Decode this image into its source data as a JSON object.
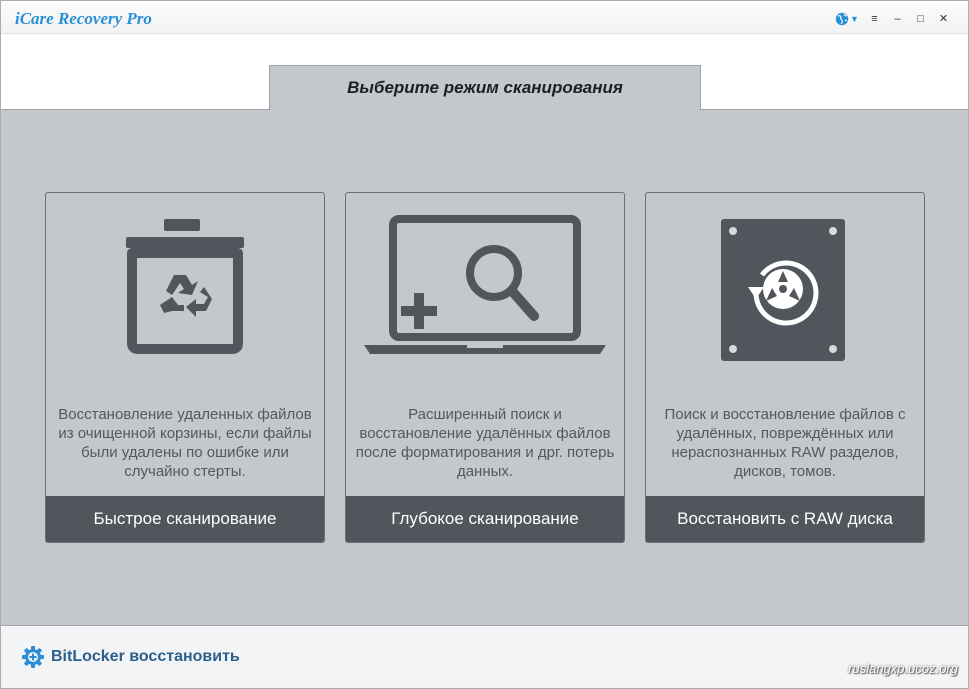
{
  "window": {
    "title": "iCare Recovery Pro",
    "controls": {
      "menu": "≡",
      "minimize": "–",
      "maximize": "□",
      "close": "✕",
      "language_dropdown": "▼"
    }
  },
  "tab": {
    "label": "Выберите режим сканирования"
  },
  "cards": [
    {
      "icon": "recycle-bin-icon",
      "description": "Восстановление удаленных файлов из очищенной корзины, если файлы были удалены по ошибке или случайно стерты.",
      "button": "Быстрое сканирование"
    },
    {
      "icon": "laptop-search-icon",
      "description": "Расширенный поиск и восстановление удалённых файлов после форматирования и дрг. потерь данных.",
      "button": "Глубокое сканирование"
    },
    {
      "icon": "hard-drive-icon",
      "description": "Поиск и восстановление файлов с удалённых, повреждённых или нераспознанных RAW разделов, дисков, томов.",
      "button": "Восстановить с RAW диска"
    }
  ],
  "footer": {
    "bitlocker_label": "BitLocker восстановить",
    "watermark": "ruslangxp.ucoz.org"
  },
  "colors": {
    "accent": "#2a8fd6",
    "panel": "#c4c7cb",
    "button": "#51555c",
    "icon": "#51555c",
    "link": "#2d5f8c"
  }
}
